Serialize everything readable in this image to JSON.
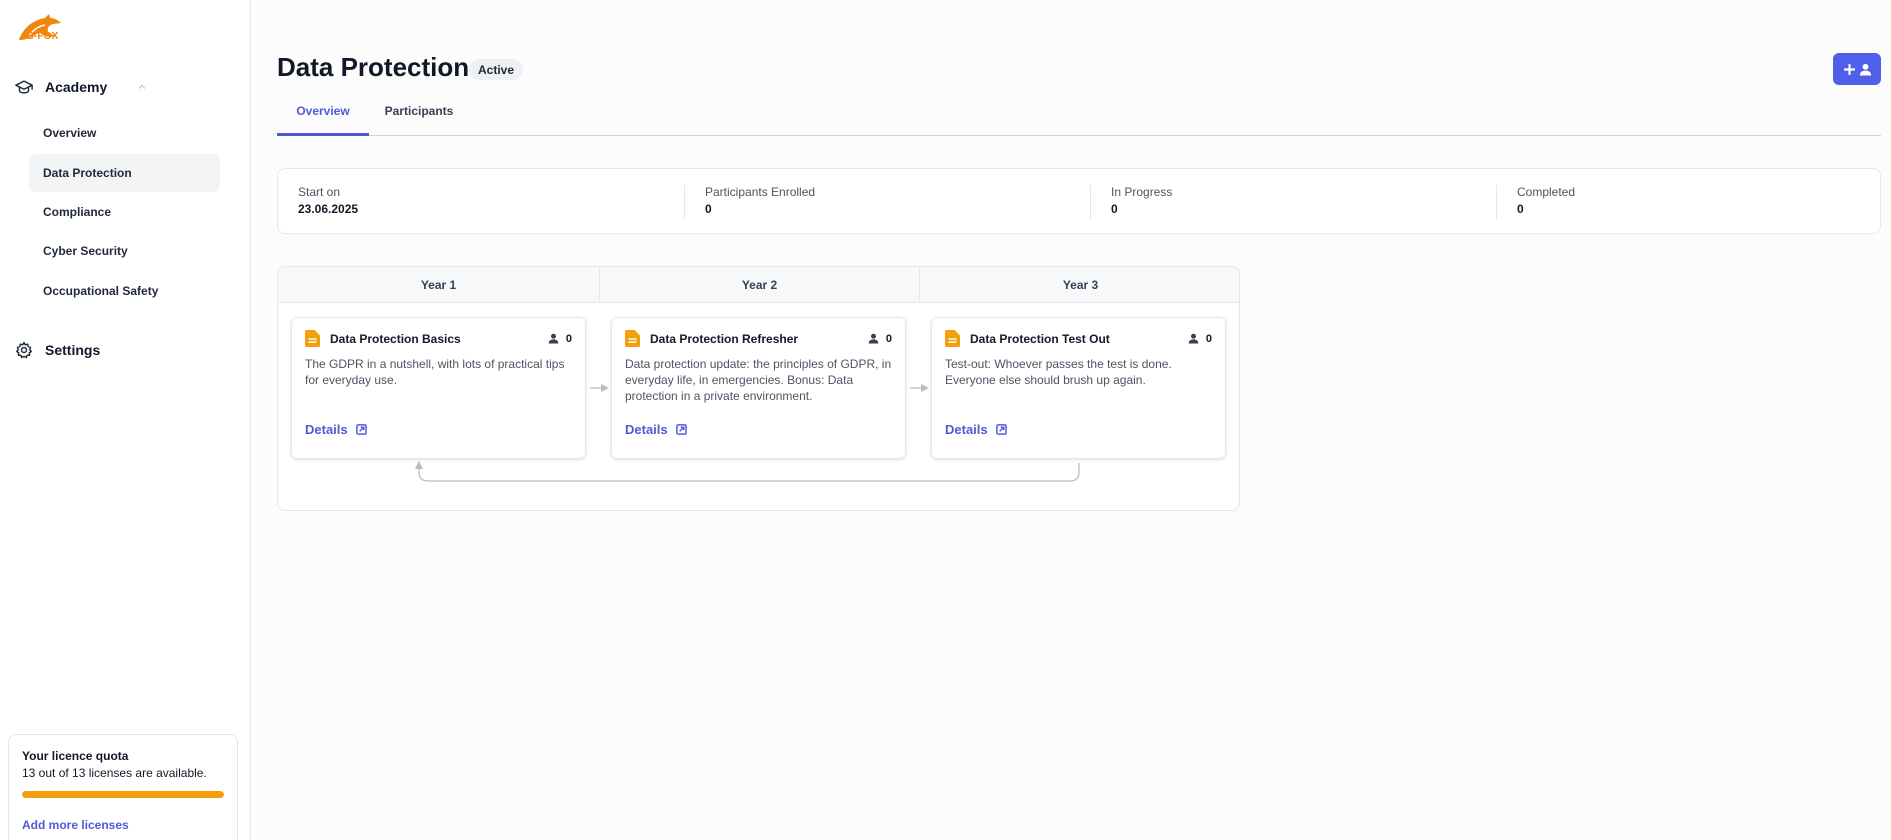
{
  "brand": {
    "logo_text": "IS-FOX",
    "accent": "#f0860c"
  },
  "sidebar": {
    "groups": [
      {
        "label": "Academy",
        "icon": "graduation-cap-icon"
      },
      {
        "label": "Settings",
        "icon": "gear-icon"
      }
    ],
    "items": [
      {
        "label": "Overview"
      },
      {
        "label": "Data Protection",
        "active": true
      },
      {
        "label": "Compliance"
      },
      {
        "label": "Cyber Security"
      },
      {
        "label": "Occupational Safety"
      }
    ],
    "quota": {
      "title": "Your licence quota",
      "text": "13 out of 13 licenses are available.",
      "fill_fraction": 1.0,
      "link": "Add more licenses",
      "bar_color": "#f59e0b"
    }
  },
  "header": {
    "title": "Data Protection",
    "status": "Active",
    "add_button_icon": "add-user-icon",
    "primary_color": "#4f5fe8"
  },
  "tabs": [
    {
      "label": "Overview",
      "active": true
    },
    {
      "label": "Participants",
      "active": false
    }
  ],
  "stats": [
    {
      "label": "Start on",
      "value": "23.06.2025"
    },
    {
      "label": "Participants Enrolled",
      "value": "0"
    },
    {
      "label": "In Progress",
      "value": "0"
    },
    {
      "label": "Completed",
      "value": "0"
    }
  ],
  "timeline": {
    "years": [
      "Year 1",
      "Year 2",
      "Year 3"
    ],
    "cards": [
      {
        "title": "Data Protection Basics",
        "count": "0",
        "description": "The GDPR in a nutshell, with lots of practical tips for everyday use.",
        "link": "Details"
      },
      {
        "title": "Data Protection Refresher",
        "count": "0",
        "description": "Data protection update: the principles of GDPR, in everyday life, in emergencies. Bonus: Data protection in a private environment.",
        "link": "Details"
      },
      {
        "title": "Data Protection Test Out",
        "count": "0",
        "description": "Test-out: Whoever passes the test is done. Everyone else should brush up again.",
        "link": "Details"
      }
    ]
  }
}
